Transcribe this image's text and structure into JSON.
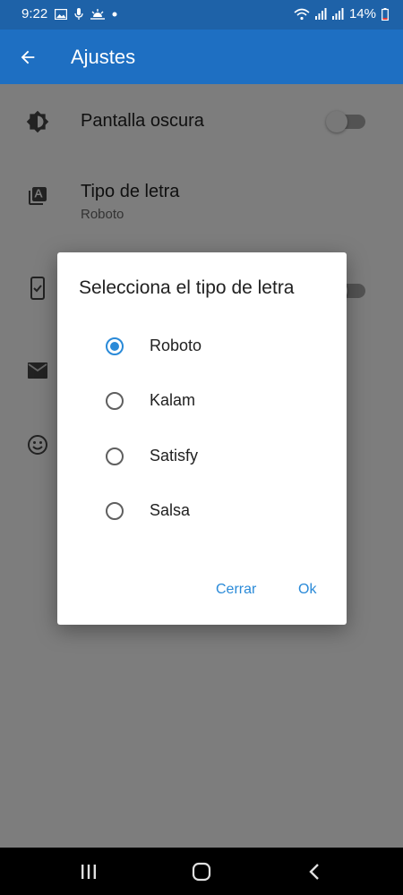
{
  "status_bar": {
    "time": "9:22",
    "battery": "14%"
  },
  "app_bar": {
    "title": "Ajustes"
  },
  "settings": [
    {
      "title": "Pantalla oscura",
      "icon": "brightness-icon"
    },
    {
      "title": "Tipo de letra",
      "subtitle": "Roboto",
      "icon": "font-icon"
    },
    {
      "icon": "phone-check-icon"
    },
    {
      "icon": "mail-icon"
    },
    {
      "icon": "smiley-icon"
    }
  ],
  "dialog": {
    "title": "Selecciona el tipo de letra",
    "options": [
      {
        "label": "Roboto",
        "selected": true
      },
      {
        "label": "Kalam",
        "selected": false
      },
      {
        "label": "Satisfy",
        "selected": false
      },
      {
        "label": "Salsa",
        "selected": false
      }
    ],
    "cancel_label": "Cerrar",
    "ok_label": "Ok"
  },
  "colors": {
    "status_bar": "#1e62a8",
    "app_bar": "#1e6fc2",
    "accent": "#2a8ad8"
  }
}
